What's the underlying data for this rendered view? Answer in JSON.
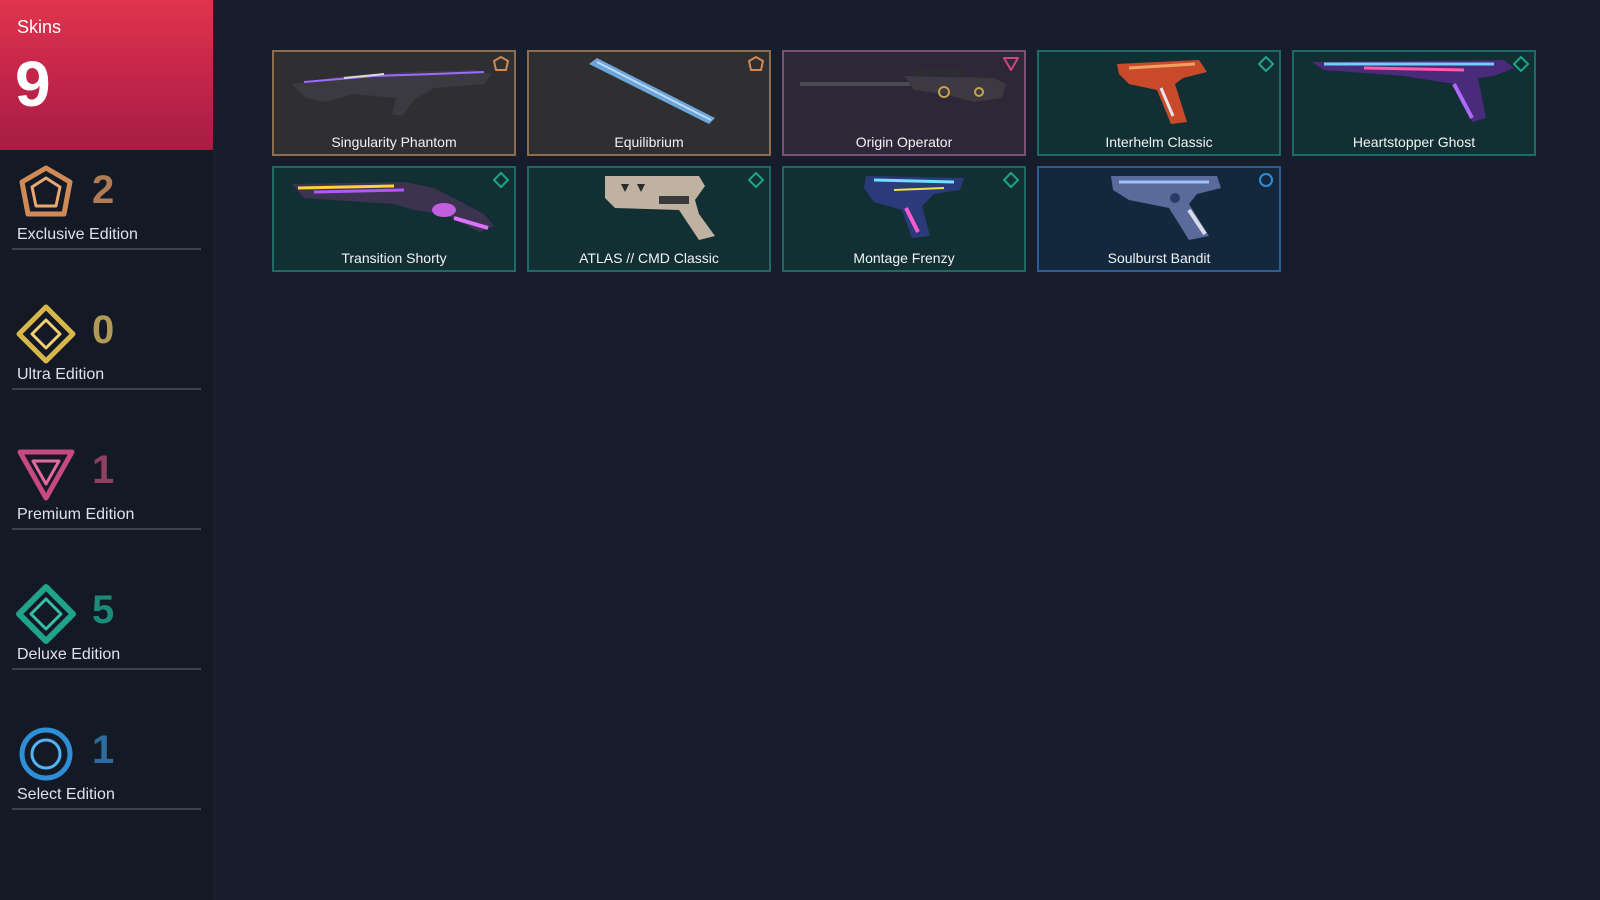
{
  "skins": {
    "label": "Skins",
    "count": "9"
  },
  "editions": [
    {
      "name": "Exclusive Edition",
      "count": "2",
      "color": "#d08a55",
      "icon": "exclusive-edition-icon"
    },
    {
      "name": "Ultra Edition",
      "count": "0",
      "color": "#d8b64a",
      "icon": "ultra-edition-icon"
    },
    {
      "name": "Premium Edition",
      "count": "1",
      "color": "#c8497f",
      "icon": "premium-edition-icon"
    },
    {
      "name": "Deluxe Edition",
      "count": "5",
      "color": "#1fa38a",
      "icon": "deluxe-edition-icon"
    },
    {
      "name": "Select Edition",
      "count": "1",
      "color": "#2f8fd6",
      "icon": "select-edition-icon"
    }
  ],
  "skin_tiles": [
    {
      "name": "Singularity Phantom",
      "tier": "exclusive"
    },
    {
      "name": "Equilibrium",
      "tier": "exclusive"
    },
    {
      "name": "Origin Operator",
      "tier": "premium"
    },
    {
      "name": "Interhelm Classic",
      "tier": "deluxe"
    },
    {
      "name": "Heartstopper Ghost",
      "tier": "deluxe"
    },
    {
      "name": "Transition Shorty",
      "tier": "deluxe"
    },
    {
      "name": "ATLAS // CMD Classic",
      "tier": "deluxe"
    },
    {
      "name": "Montage Frenzy",
      "tier": "deluxe"
    },
    {
      "name": "Soulburst Bandit",
      "tier": "select"
    }
  ]
}
